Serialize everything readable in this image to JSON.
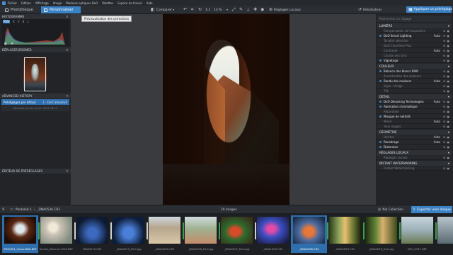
{
  "menu": [
    "Fichier",
    "Edition",
    "Affichage",
    "Image",
    "Modules optiques DxO",
    "Palettes",
    "Espace de travail",
    "Aide"
  ],
  "tabs": {
    "phototheque": "Photothèque",
    "personnaliser": "Personnaliser"
  },
  "toolbar": {
    "compare": "Comparer",
    "zoom": "13 %",
    "ratio": "1:1",
    "local": "Réglages Locaux",
    "reset": "Réinitialiser",
    "apply_preset": "Appliquer un préréglage"
  },
  "tooltip": "Prévisualisation des corrections",
  "left": {
    "histogram_title": "HISTOGRAMME",
    "channels": [
      "RVB",
      "R",
      "V",
      "B",
      "L"
    ],
    "navigator_title": "DÉPLACER/ZOOMER",
    "history_title": "ADVANCED HISTORY",
    "history_item": {
      "name": "Préréglages par défaut",
      "value": "1 - DxO Standard"
    },
    "history_sub": "Nouvelle le mer. 8 oct. 2021 18:17",
    "presets_title": "ÉDITEUR DE PRÉRÉGLAGES"
  },
  "right": {
    "search_placeholder": "Rechercher un réglage",
    "sections": [
      {
        "title": "LUMIÈRE",
        "rows": [
          {
            "label": "Compensation de l'exposition",
            "on": false,
            "auto": ""
          },
          {
            "label": "DxO Smart Lighting",
            "on": true,
            "auto": "Auto"
          },
          {
            "label": "Tonalité sélective",
            "on": false,
            "auto": ""
          },
          {
            "label": "DxO ClearView Plus",
            "on": false,
            "auto": ""
          },
          {
            "label": "Contraste",
            "on": false,
            "auto": "Auto"
          },
          {
            "label": "Courbe des tons",
            "on": false,
            "auto": ""
          },
          {
            "label": "Vignetage",
            "on": true,
            "auto": ""
          }
        ]
      },
      {
        "title": "COULEUR",
        "rows": [
          {
            "label": "Balance des blancs RAW",
            "on": true,
            "auto": ""
          },
          {
            "label": "Accentuation des couleurs",
            "on": false,
            "auto": ""
          },
          {
            "label": "Rendu des couleurs",
            "on": true,
            "auto": "Auto"
          },
          {
            "label": "Style - Virage",
            "on": false,
            "auto": ""
          },
          {
            "label": "TSL",
            "on": false,
            "auto": ""
          }
        ]
      },
      {
        "title": "DÉTAIL",
        "rows": [
          {
            "label": "DxO Denoising Technologies",
            "on": true,
            "auto": "Auto"
          },
          {
            "label": "Aberration chromatique",
            "on": true,
            "auto": ""
          },
          {
            "label": "Réparation",
            "on": false,
            "auto": ""
          },
          {
            "label": "Masque de netteté",
            "on": true,
            "auto": ""
          },
          {
            "label": "Moiré",
            "on": false,
            "auto": "Auto"
          },
          {
            "label": "Yeux rouges",
            "on": false,
            "auto": ""
          }
        ]
      },
      {
        "title": "GÉOMÉTRIE",
        "rows": [
          {
            "label": "Horizon",
            "on": false,
            "auto": "Auto"
          },
          {
            "label": "Recadrage",
            "on": true,
            "auto": "Auto"
          },
          {
            "label": "Distorsion",
            "on": true,
            "auto": ""
          }
        ]
      },
      {
        "title": "RÉGLAGES LOCAUX",
        "rows": [
          {
            "label": "Réglages Locaux",
            "on": false,
            "auto": ""
          }
        ]
      },
      {
        "title": "INSTANT WATERMARKING",
        "rows": [
          {
            "label": "Instant Watermarking",
            "on": false,
            "auto": ""
          }
        ]
      }
    ]
  },
  "filmbar": {
    "breadcrumb": [
      "Photolab 5",
      "_DNA0536.CR2"
    ],
    "count": "20 images",
    "nik": "Nik Collection",
    "export": "Exporter vers disque"
  },
  "film": [
    {
      "name": "IMG0001_Corse-DNA.NEF",
      "selected": true
    },
    {
      "name": "Amelie_Bane-ex1056.NEF",
      "selected": false
    },
    {
      "name": "DNA0019.CR2",
      "selected": false
    },
    {
      "name": "_DNA0019_DxO.jpg",
      "selected": false
    },
    {
      "name": "_DNA0096.CR2",
      "selected": false
    },
    {
      "name": "_DNA0098_DxO.jpg",
      "selected": false
    },
    {
      "name": "_DNA0097_DxO.jpg",
      "selected": false
    },
    {
      "name": "_DNA1026.CR2",
      "selected": false
    },
    {
      "name": "_DNA0536.CR2",
      "selected": true
    },
    {
      "name": "_DNA0876.CR2",
      "selected": false
    },
    {
      "name": "_DNA0878_DxO.jpg",
      "selected": false
    },
    {
      "name": "DSC_0787.NEF",
      "selected": false
    },
    {
      "name": "",
      "selected": false
    }
  ]
}
